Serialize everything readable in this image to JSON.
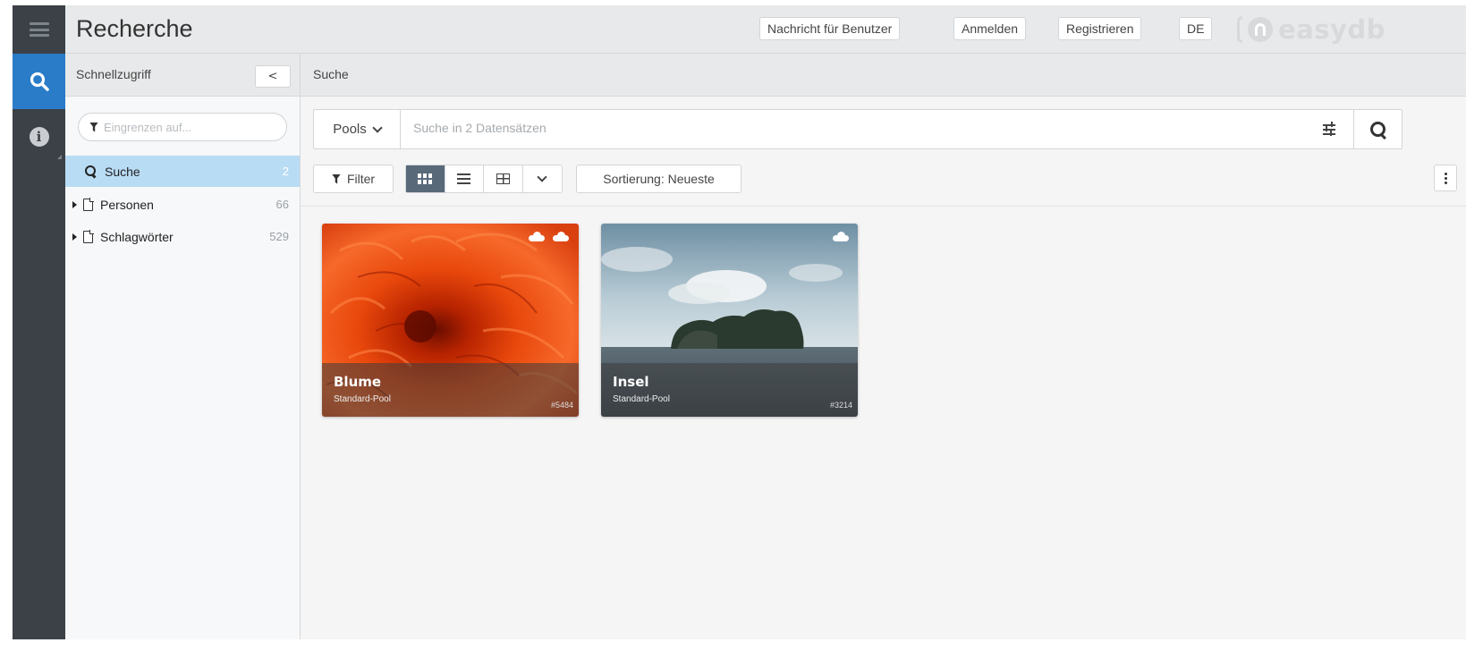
{
  "header": {
    "title": "Recherche",
    "buttons": {
      "message": "Nachricht für Benutzer",
      "login": "Anmelden",
      "register": "Registrieren",
      "language": "DE"
    },
    "logo_text": "easydb"
  },
  "rail": {
    "items": [
      "menu-icon",
      "search-icon",
      "info-icon"
    ],
    "active_color": "#2a7cc9"
  },
  "quick_access": {
    "title": "Schnellzugriff",
    "collapse_label": "<",
    "filter_placeholder": "Eingrenzen auf...",
    "items": [
      {
        "label": "Suche",
        "count": "2"
      },
      {
        "label": "Personen",
        "count": "66"
      },
      {
        "label": "Schlagwörter",
        "count": "529"
      }
    ]
  },
  "main": {
    "title": "Suche",
    "search": {
      "pools_label": "Pools",
      "placeholder": "Suche in 2 Datensätzen"
    },
    "toolbar": {
      "filter_label": "Filter",
      "sort_label": "Sortierung: Neueste"
    },
    "cards": [
      {
        "title": "Blume",
        "pool": "Standard-Pool",
        "id": "#5484"
      },
      {
        "title": "Insel",
        "pool": "Standard-Pool",
        "id": "#3214"
      }
    ]
  }
}
